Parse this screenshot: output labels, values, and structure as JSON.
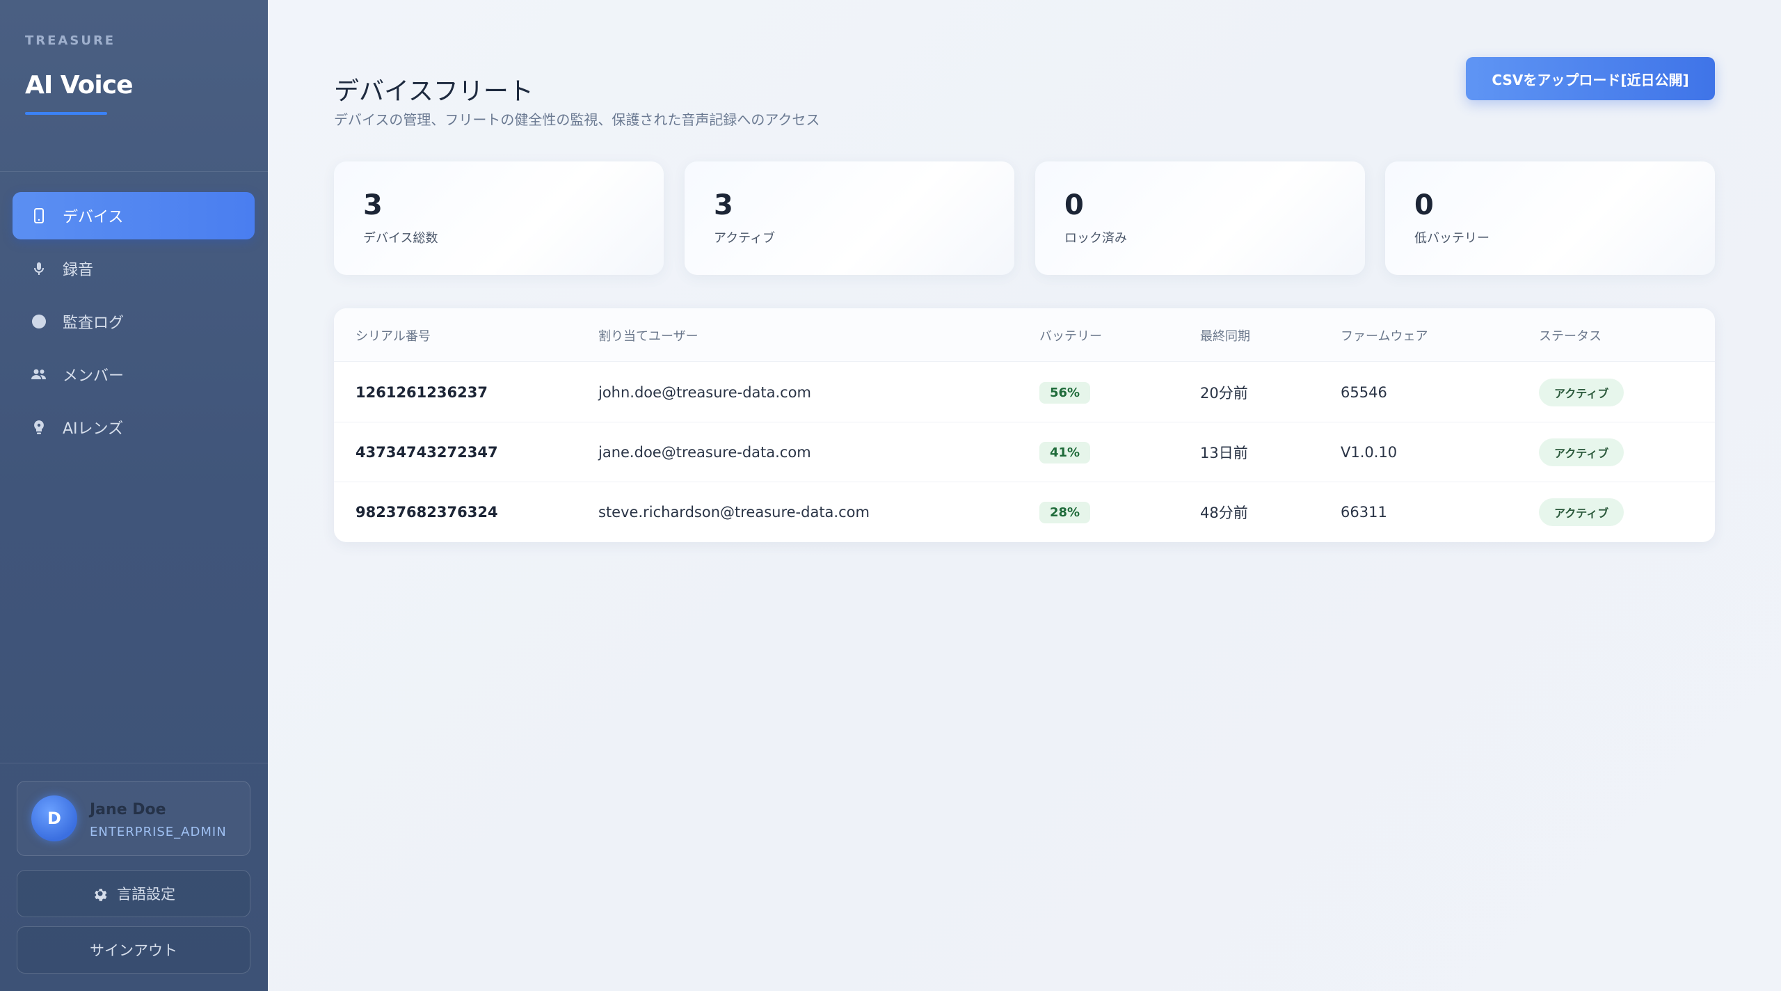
{
  "sidebar": {
    "brand_top": "TREASURE",
    "brand_name": "AI Voice",
    "items": [
      {
        "label": "デバイス",
        "icon": "phone-icon",
        "active": true
      },
      {
        "label": "録音",
        "icon": "microphone-icon",
        "active": false
      },
      {
        "label": "監査ログ",
        "icon": "circle-icon",
        "active": false
      },
      {
        "label": "メンバー",
        "icon": "people-icon",
        "active": false
      },
      {
        "label": "AIレンズ",
        "icon": "bulb-icon",
        "active": false
      }
    ],
    "user": {
      "initial": "D",
      "name": "Jane Doe",
      "role": "ENTERPRISE_ADMIN"
    },
    "language_label": "言語設定",
    "signout_label": "サインアウト"
  },
  "header": {
    "title": "デバイスフリート",
    "subtitle": "デバイスの管理、フリートの健全性の監視、保護された音声記録へのアクセス",
    "upload_label": "CSVをアップロード[近日公開]"
  },
  "stats": [
    {
      "value": "3",
      "label": "デバイス総数"
    },
    {
      "value": "3",
      "label": "アクティブ"
    },
    {
      "value": "0",
      "label": "ロック済み"
    },
    {
      "value": "0",
      "label": "低バッテリー"
    }
  ],
  "table": {
    "columns": [
      "シリアル番号",
      "割り当てユーザー",
      "バッテリー",
      "最終同期",
      "ファームウェア",
      "ステータス"
    ],
    "rows": [
      {
        "serial": "1261261236237",
        "user": "john.doe@treasure-data.com",
        "battery": "56%",
        "sync": "20分前",
        "firmware": "65546",
        "status": "アクティブ"
      },
      {
        "serial": "43734743272347",
        "user": "jane.doe@treasure-data.com",
        "battery": "41%",
        "sync": "13日前",
        "firmware": "V1.0.10",
        "status": "アクティブ"
      },
      {
        "serial": "98237682376324",
        "user": "steve.richardson@treasure-data.com",
        "battery": "28%",
        "sync": "48分前",
        "firmware": "66311",
        "status": "アクティブ"
      }
    ]
  },
  "colors": {
    "accent": "#4a7ef0",
    "sidebar_bg": "#445a7e",
    "badge_bg": "#e6f5ea",
    "badge_text": "#1f6b3a"
  }
}
